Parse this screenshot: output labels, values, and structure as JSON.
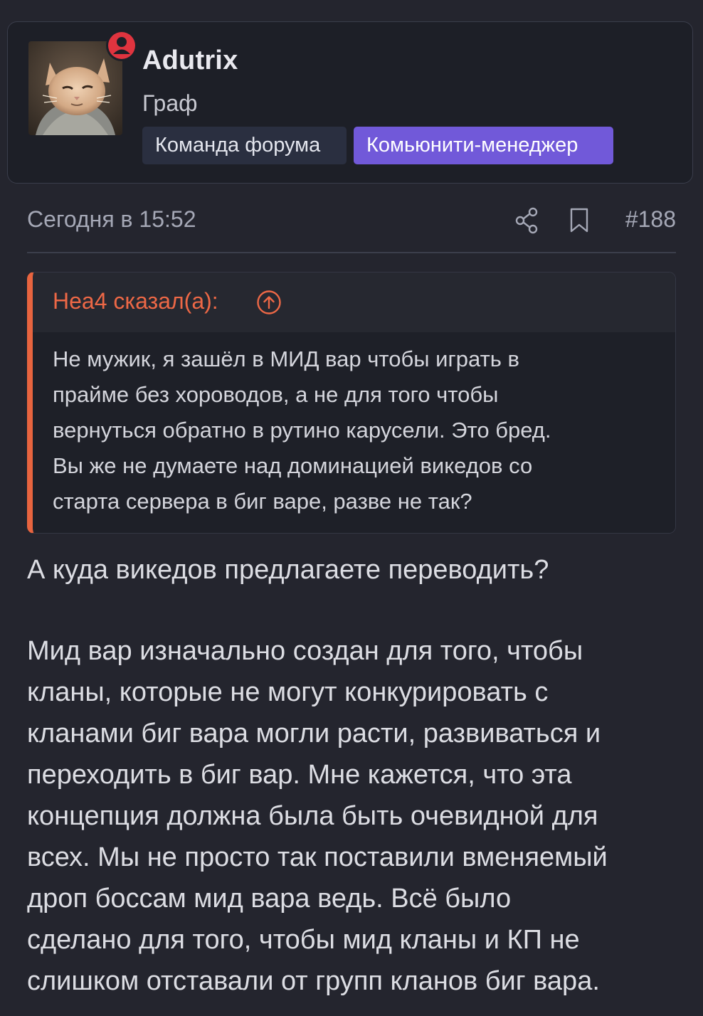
{
  "author": {
    "name": "Adutrix",
    "title": "Граф",
    "avatar_icon": "cat-avatar",
    "status_color": "#e0343f",
    "badges": [
      {
        "label": "Команда форума",
        "color": "#2a2f40"
      },
      {
        "label": "Комьюнити-менеджер",
        "color": "#7159d9"
      }
    ]
  },
  "post": {
    "date": "Сегодня в 15:52",
    "number": "#188",
    "share_icon": "share-icon",
    "bookmark_icon": "bookmark-icon"
  },
  "quote": {
    "author_line": "Неа4 сказал(а):",
    "accent_color": "#e8643f",
    "jump_icon": "arrow-up-circle-icon",
    "lines": [
      "Не мужик, я зашёл в МИД вар чтобы играть в",
      "прайме без хороводов, а не для того чтобы",
      "вернуться обратно в рутино карусели. Это бред.",
      "Вы же не думаете над доминацией викедов со",
      "старта сервера в биг варе, разве не так?"
    ]
  },
  "message": {
    "question": "А куда викедов предлагаете переводить?",
    "lines": [
      "Мид вар изначально создан для того, чтобы",
      "кланы, которые не могут конкурировать с",
      "кланами биг вара могли расти, развиваться и",
      "переходить в биг вар. Мне кажется, что эта",
      "концепция должна была быть очевидной для",
      "всех. Мы не просто так поставили вменяемый",
      "дроп боссам мид вара ведь. Всё было",
      "сделано для того, чтобы мид кланы и КП не",
      "слишком отставали от групп кланов биг вара."
    ]
  }
}
